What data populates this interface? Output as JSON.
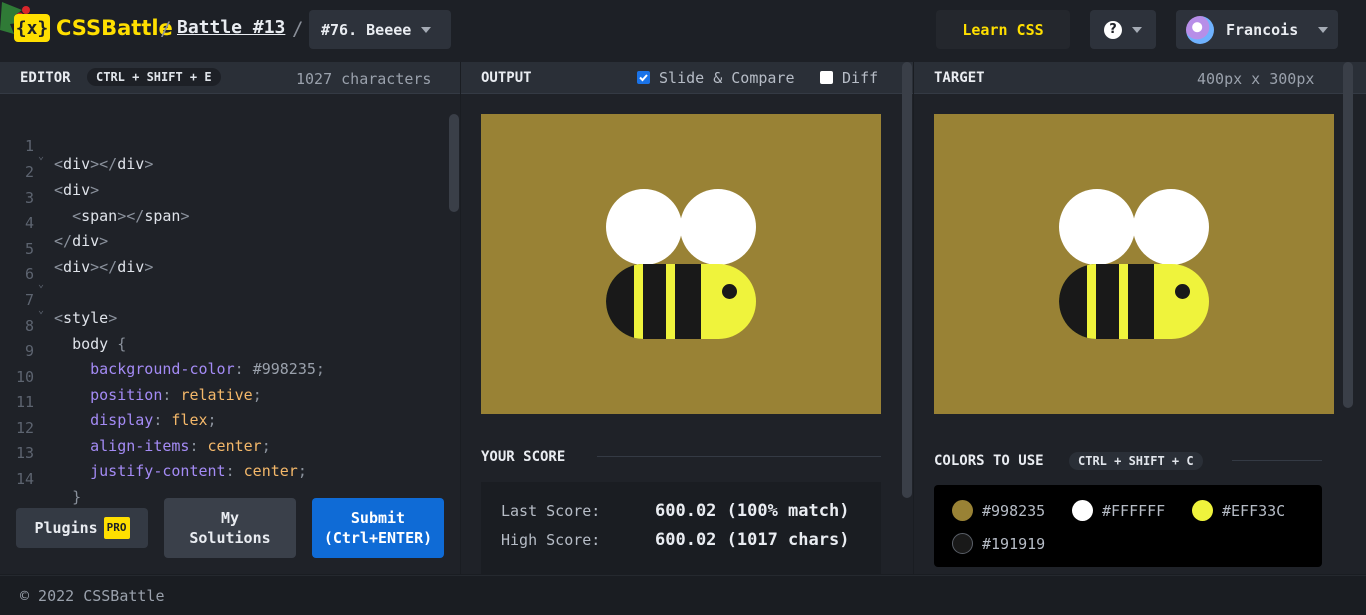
{
  "header": {
    "logo_mark": "{x}",
    "logo_text": "CSSBattle",
    "sep": "/",
    "battle": "Battle #13",
    "target_select": "#76. Beeee",
    "learn": "Learn CSS",
    "help": "?",
    "user": "Francois"
  },
  "editor": {
    "title": "EDITOR",
    "shortcut": "CTRL + SHIFT + E",
    "chars": "1027 characters",
    "line_numbers": [
      "1",
      "2",
      "3",
      "4",
      "5",
      "6",
      "7",
      "8",
      "9",
      "10",
      "11",
      "12",
      "13",
      "14"
    ]
  },
  "buttons": {
    "plugins": "Plugins",
    "pro": "PRO",
    "my_solutions_1": "My",
    "my_solutions_2": "Solutions",
    "submit_1": "Submit",
    "submit_2": "(Ctrl+ENTER)"
  },
  "output": {
    "title": "OUTPUT",
    "slide_compare": "Slide & Compare",
    "diff": "Diff",
    "slide_checked": true,
    "diff_checked": false
  },
  "target": {
    "title": "TARGET",
    "size": "400px x 300px"
  },
  "score": {
    "title": "YOUR SCORE",
    "last_label": "Last Score:",
    "last_value": "600.02 (100% match)",
    "high_label": "High Score:",
    "high_value": "600.02 (1017 chars)"
  },
  "colors": {
    "title": "COLORS TO USE",
    "shortcut": "CTRL + SHIFT + C",
    "list": [
      {
        "hex": "#998235",
        "label": "#998235"
      },
      {
        "hex": "#FFFFFF",
        "label": "#FFFFFF"
      },
      {
        "hex": "#EFF33C",
        "label": "#EFF33C"
      },
      {
        "hex": "#191919",
        "label": "#191919"
      }
    ]
  },
  "footer": "© 2022 CSSBattle"
}
